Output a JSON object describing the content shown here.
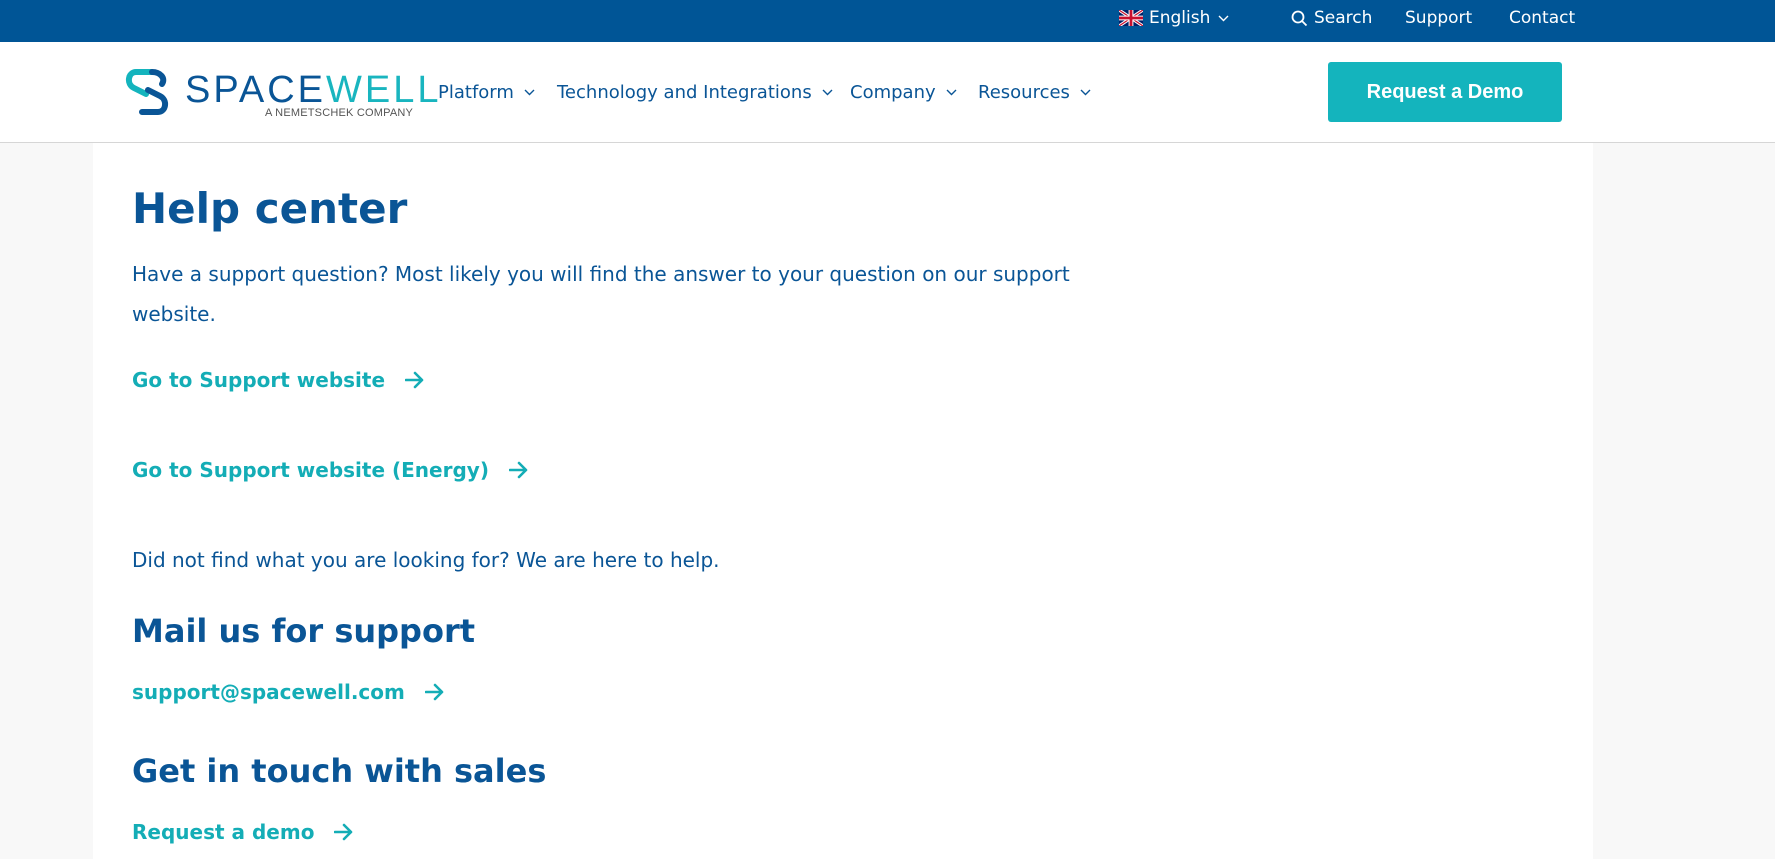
{
  "topbar": {
    "language": "English",
    "search": "Search",
    "support": "Support",
    "contact": "Contact"
  },
  "logo": {
    "brand_part1": "SPACE",
    "brand_part2": "WELL",
    "tagline": "A NEMETSCHEK COMPANY"
  },
  "nav": {
    "items": [
      {
        "label": "Platform"
      },
      {
        "label": "Technology and Integrations"
      },
      {
        "label": "Company"
      },
      {
        "label": "Resources"
      }
    ],
    "cta": "Request a Demo"
  },
  "main": {
    "title": "Help center",
    "intro": "Have a support question? Most likely you will find the answer to your question on our support website.",
    "link_support": "Go to Support website",
    "link_support_energy": "Go to Support website (Energy)",
    "not_found": "Did not find what you are looking for? We are here to help.",
    "mail_heading": "Mail us for support",
    "mail_link": "support@spacewell.com",
    "sales_heading": "Get in touch with sales",
    "sales_link": "Request a demo"
  },
  "colors": {
    "top_bar": "#005596",
    "primary_text": "#0a5596",
    "accent": "#14b4bd",
    "page_bg": "#f8f8f8"
  }
}
